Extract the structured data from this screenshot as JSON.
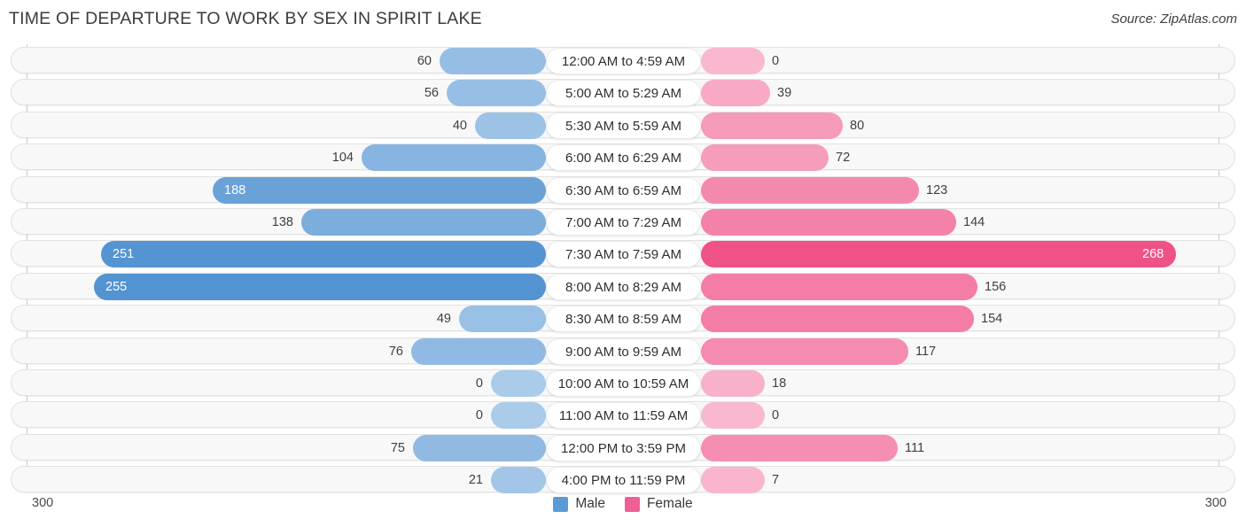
{
  "header": {
    "title": "TIME OF DEPARTURE TO WORK BY SEX IN SPIRIT LAKE",
    "source": "Source: ZipAtlas.com"
  },
  "legend": {
    "male_label": "Male",
    "female_label": "Female",
    "male_color": "#5b9bd5",
    "female_color": "#ef5f96"
  },
  "axis": {
    "left_max": "300",
    "right_max": "300"
  },
  "chart_data": {
    "type": "bar",
    "orientation": "horizontal-diverging",
    "title": "TIME OF DEPARTURE TO WORK BY SEX IN SPIRIT LAKE",
    "xlabel": "",
    "ylabel": "",
    "xlim": [
      300,
      300
    ],
    "grid": false,
    "legend_position": "bottom-center",
    "categories": [
      "12:00 AM to 4:59 AM",
      "5:00 AM to 5:29 AM",
      "5:30 AM to 5:59 AM",
      "6:00 AM to 6:29 AM",
      "6:30 AM to 6:59 AM",
      "7:00 AM to 7:29 AM",
      "7:30 AM to 7:59 AM",
      "8:00 AM to 8:29 AM",
      "8:30 AM to 8:59 AM",
      "9:00 AM to 9:59 AM",
      "10:00 AM to 10:59 AM",
      "11:00 AM to 11:59 AM",
      "12:00 PM to 3:59 PM",
      "4:00 PM to 11:59 PM"
    ],
    "series": [
      {
        "name": "Male",
        "color": "#5b9bd5",
        "values": [
          60,
          56,
          40,
          104,
          188,
          138,
          251,
          255,
          49,
          76,
          0,
          0,
          75,
          21
        ]
      },
      {
        "name": "Female",
        "color": "#ef5f96",
        "values": [
          0,
          39,
          80,
          72,
          123,
          144,
          268,
          156,
          154,
          117,
          18,
          0,
          111,
          7
        ]
      }
    ]
  },
  "rows": [
    {
      "label": "12:00 AM to 4:59 AM",
      "male": "60",
      "female": "0"
    },
    {
      "label": "5:00 AM to 5:29 AM",
      "male": "56",
      "female": "39"
    },
    {
      "label": "5:30 AM to 5:59 AM",
      "male": "40",
      "female": "80"
    },
    {
      "label": "6:00 AM to 6:29 AM",
      "male": "104",
      "female": "72"
    },
    {
      "label": "6:30 AM to 6:59 AM",
      "male": "188",
      "female": "123"
    },
    {
      "label": "7:00 AM to 7:29 AM",
      "male": "138",
      "female": "144"
    },
    {
      "label": "7:30 AM to 7:59 AM",
      "male": "251",
      "female": "268"
    },
    {
      "label": "8:00 AM to 8:29 AM",
      "male": "255",
      "female": "156"
    },
    {
      "label": "8:30 AM to 8:59 AM",
      "male": "49",
      "female": "154"
    },
    {
      "label": "9:00 AM to 9:59 AM",
      "male": "76",
      "female": "117"
    },
    {
      "label": "10:00 AM to 10:59 AM",
      "male": "0",
      "female": "18"
    },
    {
      "label": "11:00 AM to 11:59 AM",
      "male": "0",
      "female": "0"
    },
    {
      "label": "12:00 PM to 3:59 PM",
      "male": "75",
      "female": "111"
    },
    {
      "label": "4:00 PM to 11:59 PM",
      "male": "21",
      "female": "7"
    }
  ]
}
